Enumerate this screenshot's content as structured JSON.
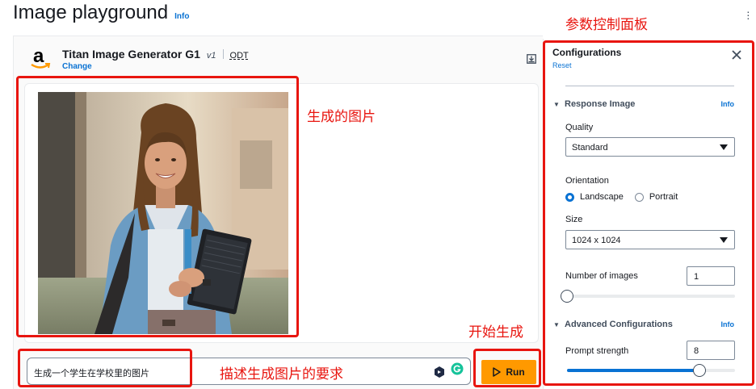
{
  "page": {
    "title": "Image playground",
    "info_label": "Info"
  },
  "model": {
    "name": "Titan Image Generator G1",
    "version": "v1",
    "tag": "ODT",
    "change_label": "Change"
  },
  "prompt": {
    "value": "生成一个学生在学校里的图片"
  },
  "run_button": {
    "label": "Run"
  },
  "config": {
    "title": "Configurations",
    "reset_label": "Reset",
    "response_image": {
      "title": "Response Image",
      "info_label": "Info",
      "quality_label": "Quality",
      "quality_value": "Standard",
      "orientation_label": "Orientation",
      "orientation_options": [
        "Landscape",
        "Portrait"
      ],
      "orientation_selected": "Landscape",
      "size_label": "Size",
      "size_value": "1024 x 1024",
      "num_images_label": "Number of images",
      "num_images_value": "1",
      "num_images_slider_fraction": 0.0
    },
    "advanced": {
      "title": "Advanced Configurations",
      "info_label": "Info",
      "prompt_strength_label": "Prompt strength",
      "prompt_strength_value": "8",
      "prompt_strength_slider_fraction": 0.79
    }
  },
  "annotations": {
    "config_panel": "参数控制面板",
    "generated_image": "生成的图片",
    "start_generate": "开始生成",
    "describe_prompt": "描述生成图片的要求"
  },
  "colors": {
    "accent": "#0972d3",
    "run_button": "#ff9900",
    "annotation": "#e8150f"
  },
  "icons": {
    "more": "kebab-menu-icon",
    "download": "download-icon",
    "close": "close-icon",
    "run": "play-icon"
  }
}
